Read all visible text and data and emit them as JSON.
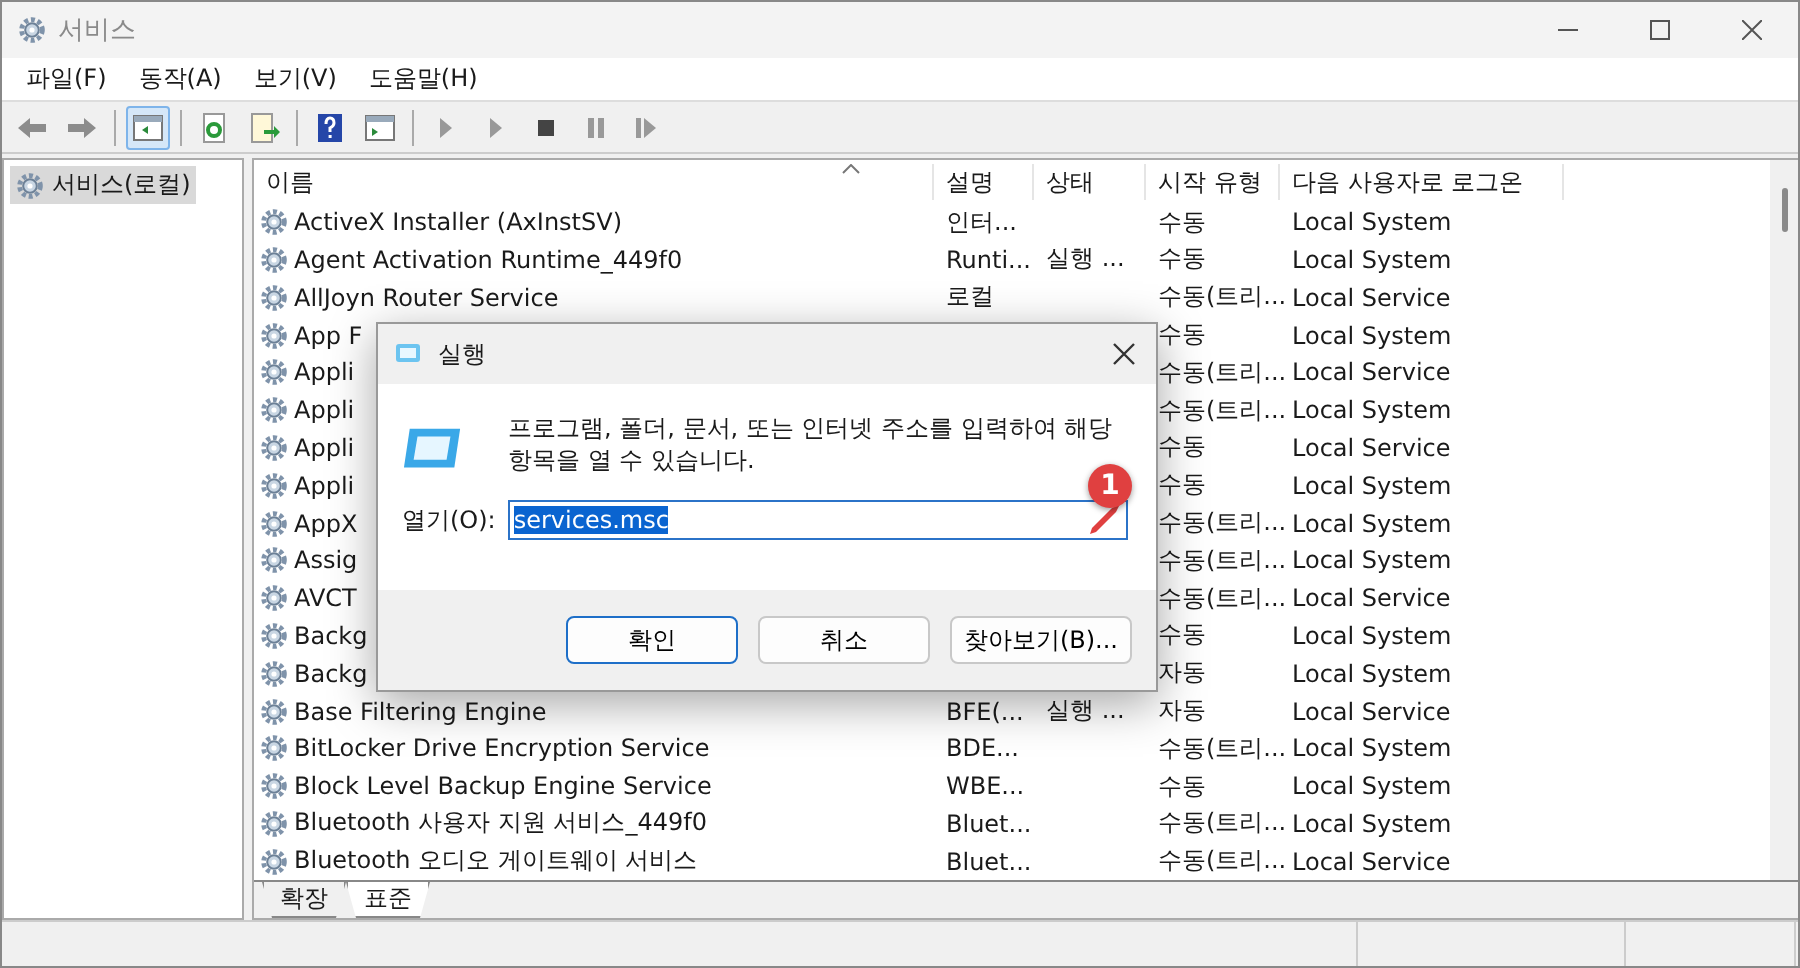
{
  "window": {
    "title": "서비스"
  },
  "menu": [
    "파일(F)",
    "동작(A)",
    "보기(V)",
    "도움말(H)"
  ],
  "toolbar": {
    "console_tree_pressed": true
  },
  "sidebar": {
    "items": [
      {
        "label": "서비스(로컬)",
        "selected": true
      }
    ]
  },
  "table": {
    "columns": [
      "이름",
      "설명",
      "상태",
      "시작 유형",
      "다음 사용자로 로그온"
    ],
    "rows": [
      {
        "name": "ActiveX Installer (AxInstSV)",
        "description": "인터...",
        "status": "",
        "startup": "수동",
        "logon": "Local System"
      },
      {
        "name": "Agent Activation Runtime_449f0",
        "description": "Runti...",
        "status": "실행 ...",
        "startup": "수동",
        "logon": "Local System"
      },
      {
        "name": "AllJoyn Router Service",
        "description": "로컬",
        "status": "",
        "startup": "수동(트리...",
        "logon": "Local Service"
      },
      {
        "name": "App F",
        "description": "",
        "status": "",
        "startup": "수동",
        "logon": "Local System"
      },
      {
        "name": "Appli",
        "description": "",
        "status": "",
        "startup": "수동(트리...",
        "logon": "Local Service"
      },
      {
        "name": "Appli",
        "description": "",
        "status": "",
        "startup": "수동(트리...",
        "logon": "Local System"
      },
      {
        "name": "Appli",
        "description": "",
        "status": "",
        "startup": "수동",
        "logon": "Local Service"
      },
      {
        "name": "Appli",
        "description": "",
        "status": "",
        "startup": "수동",
        "logon": "Local System"
      },
      {
        "name": "AppX",
        "description": "",
        "status": "",
        "startup": "수동(트리...",
        "logon": "Local System"
      },
      {
        "name": "Assig",
        "description": "",
        "status": "",
        "startup": "수동(트리...",
        "logon": "Local System"
      },
      {
        "name": "AVCT",
        "description": "",
        "status": "",
        "startup": "수동(트리...",
        "logon": "Local Service"
      },
      {
        "name": "Backg",
        "description": "",
        "status": "",
        "startup": "수동",
        "logon": "Local System"
      },
      {
        "name": "Backg",
        "description": "",
        "status": "",
        "startup": "자동",
        "logon": "Local System"
      },
      {
        "name": "Base Filtering Engine",
        "description": "BFE(...",
        "status": "실행 ...",
        "startup": "자동",
        "logon": "Local Service"
      },
      {
        "name": "BitLocker Drive Encryption Service",
        "description": "BDE...",
        "status": "",
        "startup": "수동(트리...",
        "logon": "Local System"
      },
      {
        "name": "Block Level Backup Engine Service",
        "description": "WBE...",
        "status": "",
        "startup": "수동",
        "logon": "Local System"
      },
      {
        "name": "Bluetooth 사용자 지원 서비스_449f0",
        "description": "Bluet...",
        "status": "",
        "startup": "수동(트리...",
        "logon": "Local System"
      },
      {
        "name": "Bluetooth 오디오 게이트웨이 서비스",
        "description": "Bluet...",
        "status": "",
        "startup": "수동(트리...",
        "logon": "Local Service"
      }
    ]
  },
  "view_tabs": [
    {
      "label": "확장",
      "selected": false
    },
    {
      "label": "표준",
      "selected": true
    }
  ],
  "run_dialog": {
    "title": "실행",
    "message": "프로그램, 폴더, 문서, 또는 인터넷 주소를 입력하여 해당 항목을 열 수 있습니다.",
    "open_label": "열기(O):",
    "open_value": "services.msc",
    "buttons": [
      {
        "label": "확인",
        "kind": "primary"
      },
      {
        "label": "취소",
        "kind": "normal"
      },
      {
        "label": "찾아보기(B)...",
        "kind": "normal"
      }
    ],
    "callout": "1"
  }
}
